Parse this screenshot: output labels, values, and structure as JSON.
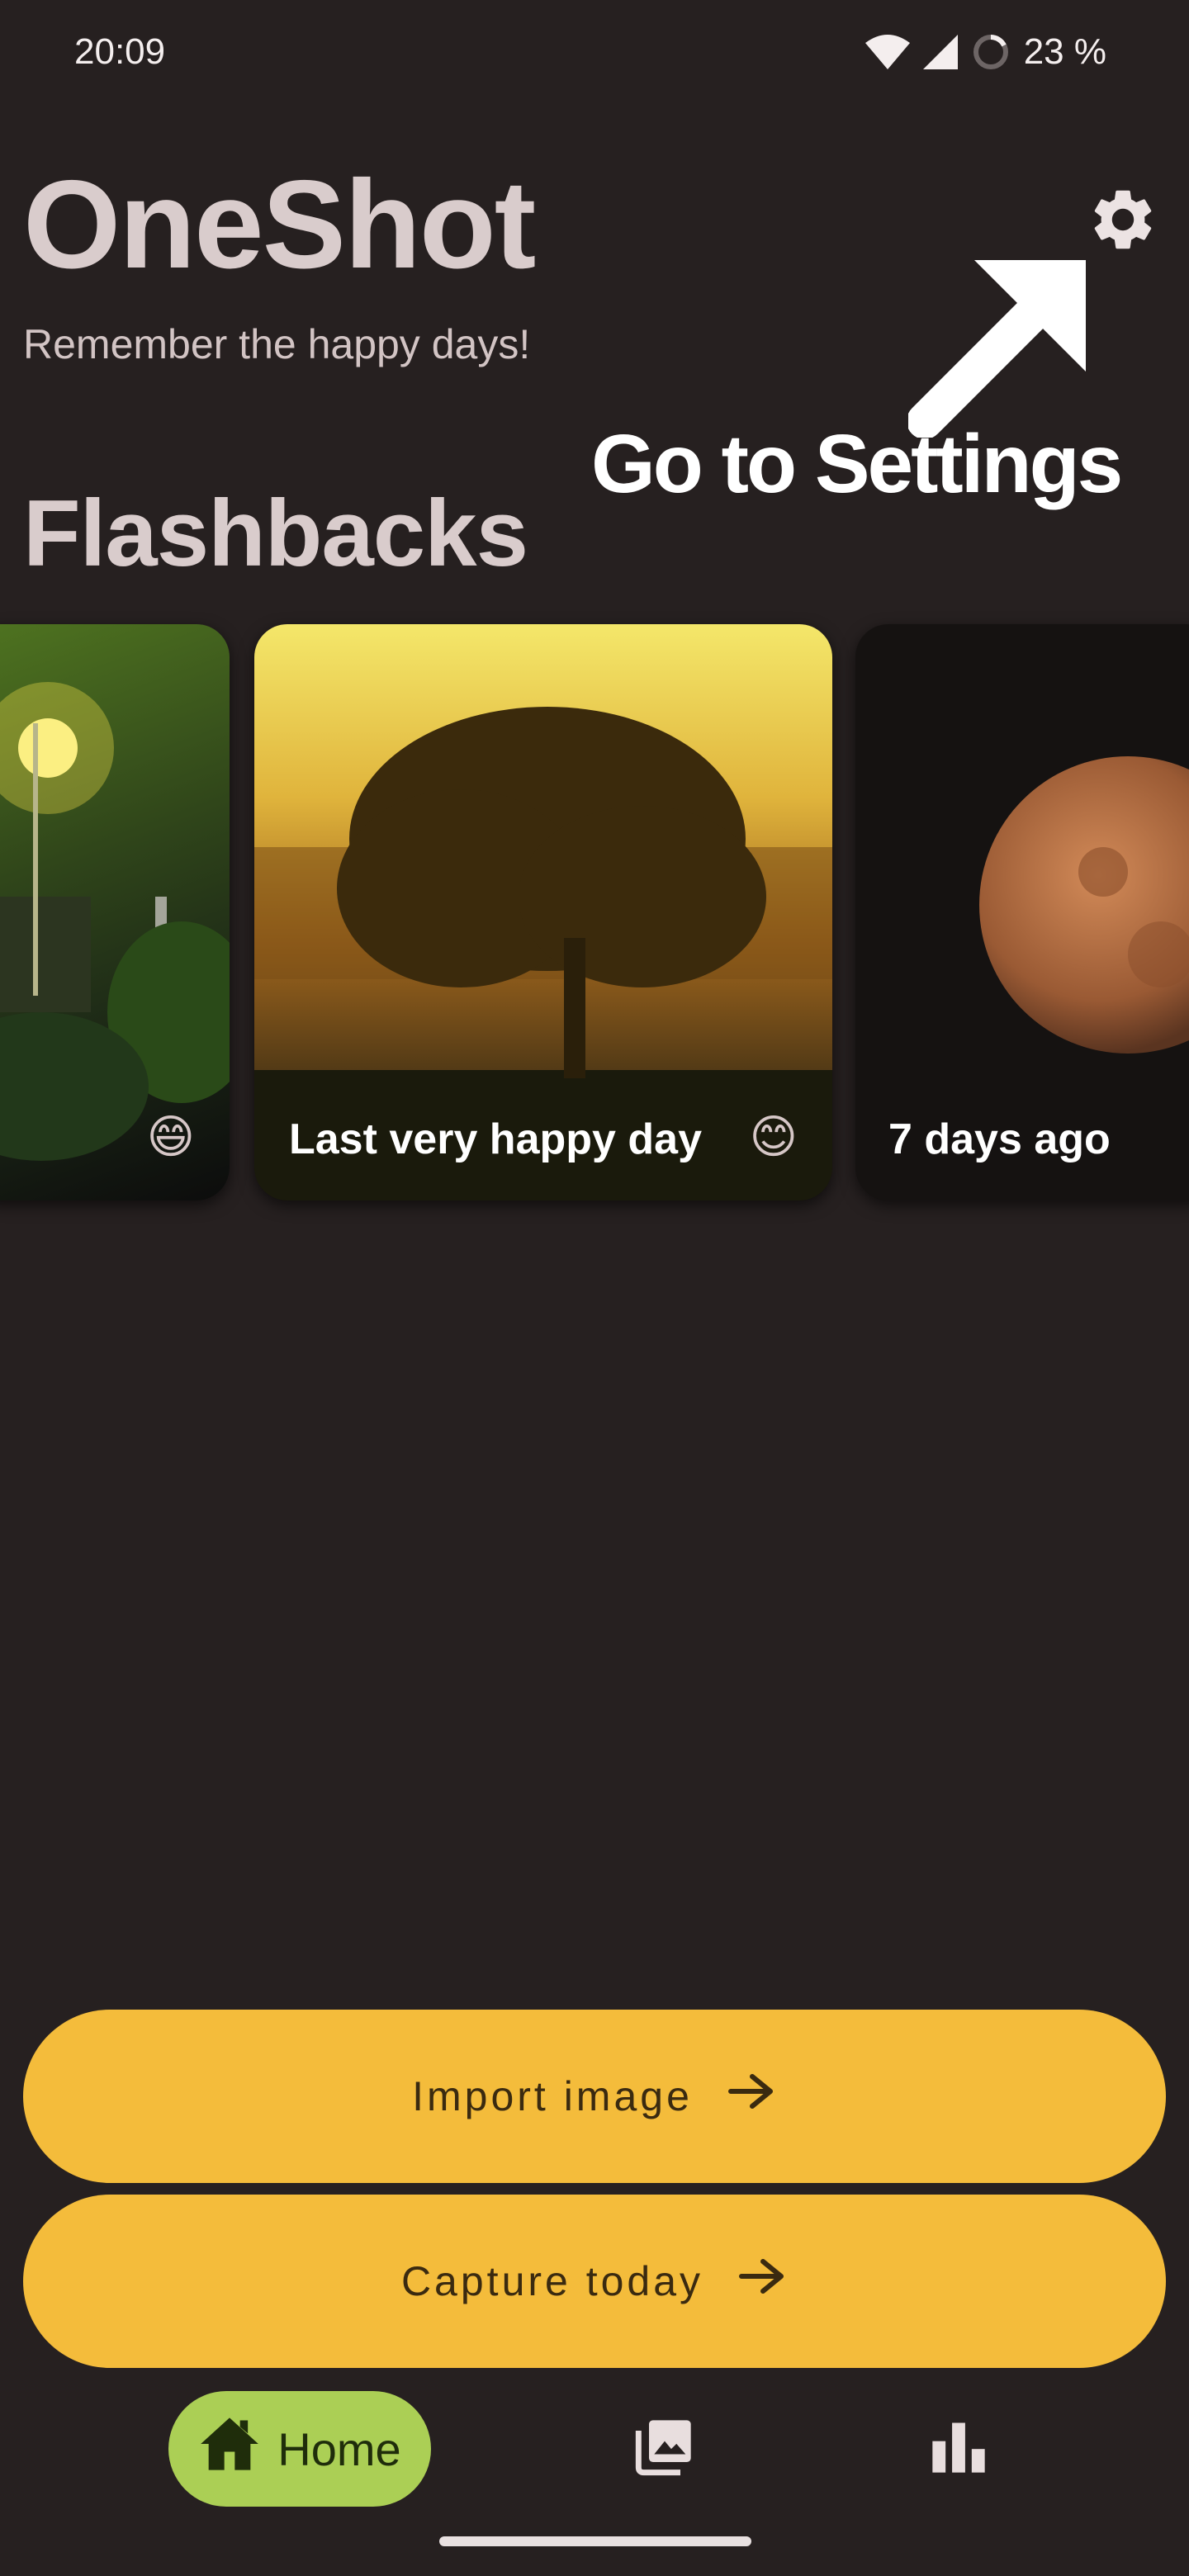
{
  "status_bar": {
    "time": "20:09",
    "battery": "23 %"
  },
  "header": {
    "title": "OneShot",
    "subtitle": "Remember the happy days!",
    "settings_icon": "gear-icon"
  },
  "overlay": {
    "hint": "Go to Settings"
  },
  "flashbacks": {
    "title": "Flashbacks",
    "cards": [
      {
        "label": "",
        "emoji": "😄"
      },
      {
        "label": "Last very happy day",
        "emoji": "😊"
      },
      {
        "label": "7 days ago",
        "emoji": ""
      }
    ]
  },
  "actions": {
    "import_label": "Import image",
    "capture_label": "Capture today"
  },
  "nav": {
    "home_label": "Home"
  },
  "colors": {
    "background": "#262020",
    "accent": "#f4bc3b",
    "nav_active": "#abcf55"
  }
}
